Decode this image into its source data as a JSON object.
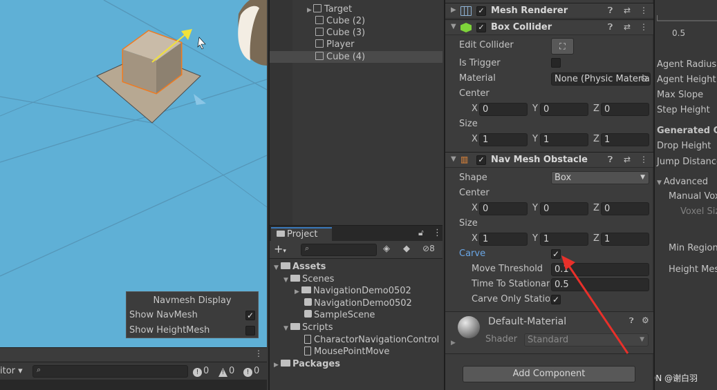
{
  "hierarchy": {
    "items": [
      {
        "label": "Target"
      },
      {
        "label": "Cube (2)"
      },
      {
        "label": "Cube (3)"
      },
      {
        "label": "Player"
      },
      {
        "label": "Cube (4)"
      }
    ]
  },
  "scene": {
    "nav_panel": {
      "title": "Navmesh Display",
      "show_navmesh": "Show NavMesh",
      "show_heightmesh": "Show HeightMesh"
    }
  },
  "console": {
    "dropdown_label": "itor",
    "info_count": "0",
    "warn_count": "0",
    "error_count": "0"
  },
  "project": {
    "tab_label": "Project",
    "hidden_count": "8",
    "tree": {
      "assets": "Assets",
      "scenes": "Scenes",
      "scene_folder": "NavigationDemo0502",
      "scene_file": "NavigationDemo0502",
      "sample_scene": "SampleScene",
      "scripts": "Scripts",
      "script1": "CharactorNavigationControl",
      "script2": "MousePointMove",
      "packages": "Packages"
    }
  },
  "inspector": {
    "mesh_renderer": "Mesh Renderer",
    "box_collider": {
      "title": "Box Collider",
      "edit_collider": "Edit Collider",
      "is_trigger": "Is Trigger",
      "material": "Material",
      "material_value": "None (Physic Material)",
      "center": "Center",
      "center_x": "0",
      "center_y": "0",
      "center_z": "0",
      "size": "Size",
      "size_x": "1",
      "size_y": "1",
      "size_z": "1"
    },
    "nav_mesh_obstacle": {
      "title": "Nav Mesh Obstacle",
      "shape": "Shape",
      "shape_value": "Box",
      "center": "Center",
      "center_x": "0",
      "center_y": "0",
      "center_z": "0",
      "size": "Size",
      "size_x": "1",
      "size_y": "1",
      "size_z": "1",
      "carve": "Carve",
      "move_threshold": "Move Threshold",
      "move_threshold_value": "0.1",
      "time_to_stationary": "Time To Stationary",
      "time_to_stationary_value": "0.5",
      "carve_only_stationary": "Carve Only Stationary"
    },
    "material": {
      "name": "Default-Material",
      "shader_label": "Shader",
      "shader_value": "Standard"
    },
    "add_component": "Add Component",
    "axis_x": "X",
    "axis_y": "Y",
    "axis_z": "Z"
  },
  "navigation_panel": {
    "slider_value": "0.5",
    "agent_radius": "Agent Radius",
    "agent_height": "Agent Height",
    "max_slope": "Max Slope",
    "step_height": "Step Height",
    "generated": "Generated Off",
    "drop_height": "Drop Height",
    "jump_distance": "Jump Distance",
    "advanced": "Advanced",
    "manual_voxel": "Manual Voxel",
    "voxel_size": "Voxel Size",
    "min_region": "Min Region",
    "height_mesh": "Height Mesh"
  },
  "watermark": "CSDN @谢白羽",
  "colors": {
    "accent": "#3a79bb",
    "scene_bg": "#5fb0d6",
    "arrow": "#e8302a",
    "carve_label": "#6aa6e6"
  }
}
